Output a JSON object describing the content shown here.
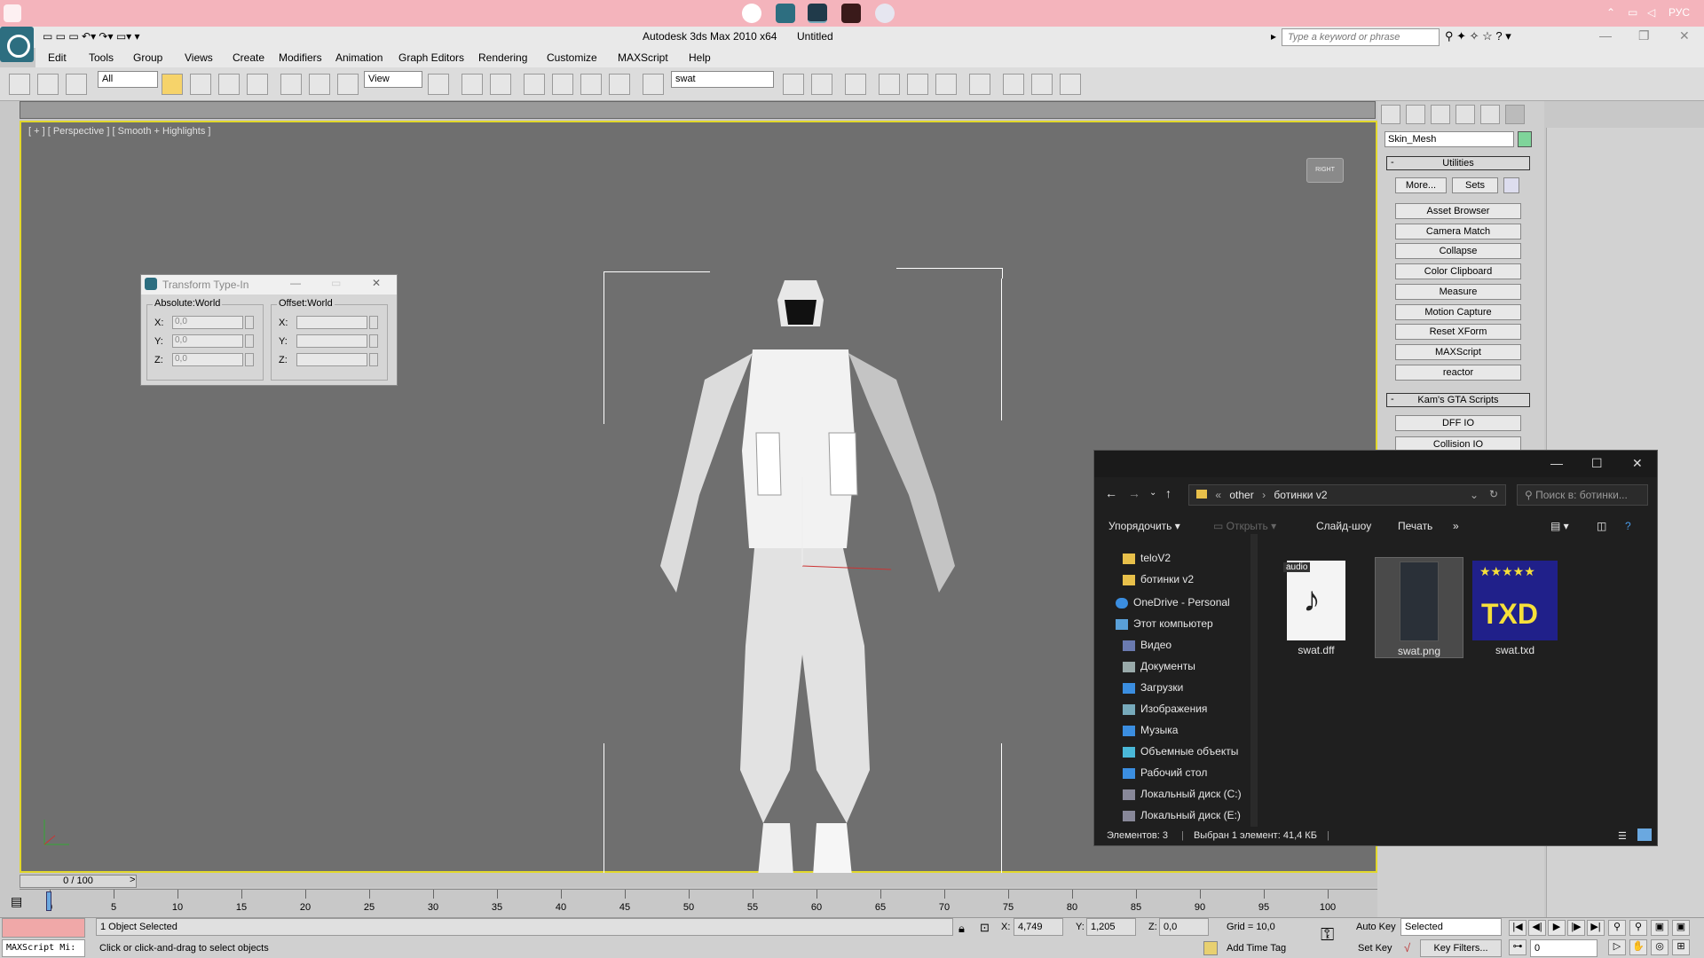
{
  "taskbar": {
    "tray_lang": "РУС"
  },
  "app": {
    "title": "Autodesk 3ds Max  2010 x64",
    "document": "Untitled",
    "search_placeholder": "Type a keyword or phrase"
  },
  "menu": [
    "Edit",
    "Tools",
    "Group",
    "Views",
    "Create",
    "Modifiers",
    "Animation",
    "Graph Editors",
    "Rendering",
    "Customize",
    "MAXScript",
    "Help"
  ],
  "toolbar": {
    "filter": "All",
    "ref_coord": "View",
    "named_set": "swat"
  },
  "viewport": {
    "label": "[ + ] [ Perspective ] [ Smooth + Highlights ]",
    "viewcube": "RIGHT"
  },
  "transform_typein": {
    "title": "Transform Type-In",
    "absolute": {
      "label": "Absolute:World",
      "x": "0,0",
      "y": "0,0",
      "z": "0,0"
    },
    "offset": {
      "label": "Offset:World",
      "x": "",
      "y": "",
      "z": ""
    },
    "axis_labels": {
      "x": "X:",
      "y": "Y:",
      "z": "Z:"
    }
  },
  "command_panel": {
    "object_name": "Skin_Mesh",
    "object_color": "#7fd49a",
    "utilities_label": "Utilities",
    "more_label": "More...",
    "sets_label": "Sets",
    "utilities": [
      "Asset Browser",
      "Camera Match",
      "Collapse",
      "Color Clipboard",
      "Measure",
      "Motion Capture",
      "Reset XForm",
      "MAXScript",
      "reactor"
    ],
    "kams_label": "Kam's GTA Scripts",
    "kams": [
      "DFF IO",
      "Collision IO"
    ]
  },
  "explorer": {
    "breadcrumb": [
      "other",
      "ботинки v2"
    ],
    "search_placeholder": "Поиск в: ботинки...",
    "commands": {
      "organize": "Упорядочить",
      "open": "Открыть",
      "slideshow": "Слайд-шоу",
      "print": "Печать",
      "more": "»"
    },
    "nav": [
      "teloV2",
      "ботинки v2",
      "OneDrive - Personal",
      "Этот компьютер",
      "Видео",
      "Документы",
      "Загрузки",
      "Изображения",
      "Музыка",
      "Объемные объекты",
      "Рабочий стол",
      "Локальный диск (C:)",
      "Локальный диск (E:)"
    ],
    "files": [
      {
        "name": "swat.dff",
        "tag": "audio"
      },
      {
        "name": "swat.png"
      },
      {
        "name": "swat.txd",
        "badge": "TXD"
      }
    ],
    "status": {
      "count": "Элементов: 3",
      "selected": "Выбран 1 элемент: 41,4 КБ"
    }
  },
  "timeline": {
    "frame": "0 / 100",
    "ticks": [
      0,
      5,
      10,
      15,
      20,
      25,
      30,
      35,
      40,
      45,
      50,
      55,
      60,
      65,
      70,
      75,
      80,
      85,
      90,
      95,
      100
    ]
  },
  "status": {
    "selection": "1 Object Selected",
    "prompt": "Click or click-and-drag to select objects",
    "maxscript": "MAXScript Mi:",
    "x": "4,749",
    "y": "1,205",
    "z": "0,0",
    "x_label": "X:",
    "y_label": "Y:",
    "z_label": "Z:",
    "grid": "Grid = 10,0",
    "add_time_tag": "Add Time Tag",
    "auto_key": "Auto Key",
    "set_key": "Set Key",
    "key_mode": "Selected",
    "key_filters": "Key Filters...",
    "current_frame": "0"
  }
}
